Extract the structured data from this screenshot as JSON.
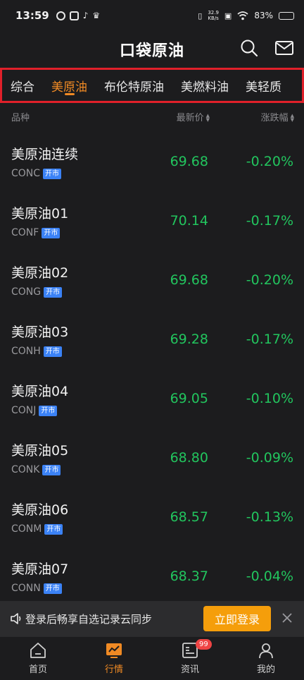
{
  "status_bar": {
    "time": "13:59",
    "net_speed_value": "32.9",
    "net_speed_unit": "KB/s",
    "battery": "83%",
    "battery_level": 0.83
  },
  "header": {
    "logo": "口袋原油"
  },
  "tabs": [
    {
      "label": "综合",
      "active": false
    },
    {
      "label": "美原油",
      "active": true
    },
    {
      "label": "布伦特原油",
      "active": false
    },
    {
      "label": "美燃料油",
      "active": false
    },
    {
      "label": "美轻质",
      "active": false
    }
  ],
  "columns": {
    "name": "品种",
    "price": "最新价",
    "change": "涨跌幅"
  },
  "rows": [
    {
      "name": "美原油连续",
      "code": "CONC",
      "badge": "开市",
      "price": "69.68",
      "change": "-0.20%"
    },
    {
      "name": "美原油01",
      "code": "CONF",
      "badge": "开市",
      "price": "70.14",
      "change": "-0.17%"
    },
    {
      "name": "美原油02",
      "code": "CONG",
      "badge": "开市",
      "price": "69.68",
      "change": "-0.20%"
    },
    {
      "name": "美原油03",
      "code": "CONH",
      "badge": "开市",
      "price": "69.28",
      "change": "-0.17%"
    },
    {
      "name": "美原油04",
      "code": "CONJ",
      "badge": "开市",
      "price": "69.05",
      "change": "-0.10%"
    },
    {
      "name": "美原油05",
      "code": "CONK",
      "badge": "开市",
      "price": "68.80",
      "change": "-0.09%"
    },
    {
      "name": "美原油06",
      "code": "CONM",
      "badge": "开市",
      "price": "68.57",
      "change": "-0.13%"
    },
    {
      "name": "美原油07",
      "code": "CONN",
      "badge": "开市",
      "price": "68.37",
      "change": "-0.04%"
    }
  ],
  "banner": {
    "text": "登录后畅享自选记录云同步",
    "login_label": "立即登录"
  },
  "bottom_nav": [
    {
      "label": "首页",
      "icon": "home-icon",
      "active": false
    },
    {
      "label": "行情",
      "icon": "market-chart-icon",
      "active": true
    },
    {
      "label": "资讯",
      "icon": "news-icon",
      "active": false,
      "badge": "99"
    },
    {
      "label": "我的",
      "icon": "profile-icon",
      "active": false
    }
  ],
  "colors": {
    "accent": "#f08a24",
    "down": "#22c55e",
    "tab_highlight_border": "#e0202a",
    "login_button": "#f59e0b"
  }
}
